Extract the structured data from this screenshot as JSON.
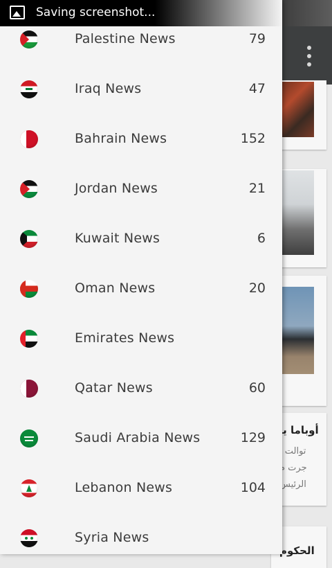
{
  "status_bar": {
    "notification_text": "Saving screenshot...",
    "icon": "image-icon"
  },
  "background": {
    "menu_icon": "overflow-menu-icon",
    "headline": "أوباما يـ",
    "snippet_lines": [
      "توالت ا",
      "جرت م",
      "الرئيس"
    ],
    "headline2": "الحكوم"
  },
  "drawer": {
    "items": [
      {
        "label": "Palestine News",
        "count": "79",
        "flag": "palestine"
      },
      {
        "label": "Iraq News",
        "count": "47",
        "flag": "iraq"
      },
      {
        "label": "Bahrain News",
        "count": "152",
        "flag": "bahrain"
      },
      {
        "label": "Jordan News",
        "count": "21",
        "flag": "jordan"
      },
      {
        "label": "Kuwait News",
        "count": "6",
        "flag": "kuwait"
      },
      {
        "label": "Oman News",
        "count": "20",
        "flag": "oman"
      },
      {
        "label": "Emirates News",
        "count": "",
        "flag": "uae"
      },
      {
        "label": "Qatar News",
        "count": "60",
        "flag": "qatar"
      },
      {
        "label": "Saudi Arabia News",
        "count": "129",
        "flag": "saudi"
      },
      {
        "label": "Lebanon News",
        "count": "104",
        "flag": "lebanon"
      },
      {
        "label": "Syria News",
        "count": "",
        "flag": "syria"
      }
    ]
  },
  "colors": {
    "toolbar": "#3d3f40",
    "drawer_bg": "#f4f4f4",
    "text": "#3b3b3b"
  }
}
